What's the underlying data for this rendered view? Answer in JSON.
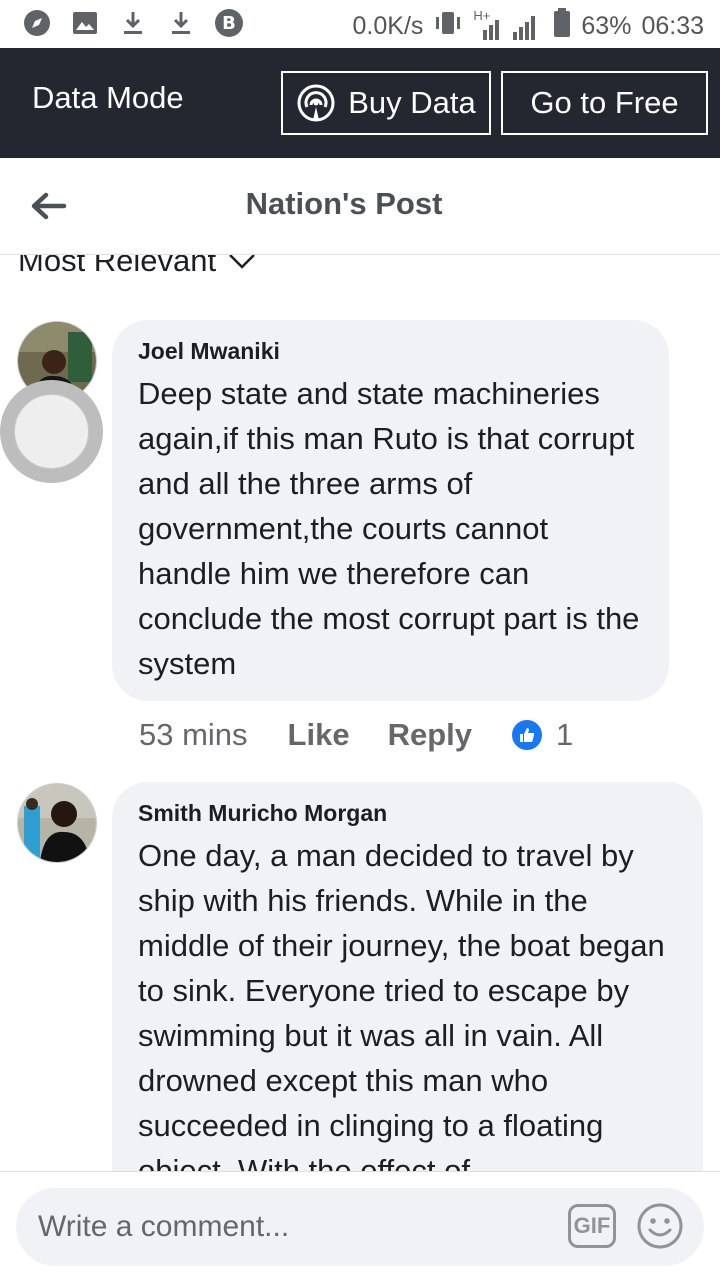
{
  "status_bar": {
    "speed": "0.0K/s",
    "network": "H+",
    "battery": "63%",
    "time": "06:33",
    "icons": [
      "compass-icon",
      "image-icon",
      "download-icon",
      "download-icon",
      "b-badge-icon",
      "vibrate-icon",
      "signal-icon",
      "battery-icon"
    ]
  },
  "data_bar": {
    "label": "Data Mode",
    "buy_label": "Buy Data",
    "free_label": "Go to Free"
  },
  "header": {
    "title": "Nation's Post"
  },
  "sort": {
    "label": "Most Relevant"
  },
  "comments": [
    {
      "author": "Joel Mwaniki",
      "text": "Deep state and state machineries again,if this man Ruto is that corrupt and all the three arms of government,the courts cannot handle him we therefore can conclude the most corrupt part is the system",
      "time": "53 mins",
      "like_label": "Like",
      "reply_label": "Reply",
      "reactions": "1"
    },
    {
      "author": "Smith Muricho Morgan",
      "text": "One day, a man decided to travel by ship with his friends. While in the middle of their journey, the boat began to sink. Everyone tried to escape by swimming but it was all in vain. All drowned except this man who succeeded in clinging to a floating object. With the effect of"
    }
  ],
  "composer": {
    "placeholder": "Write a comment...",
    "gif_label": "GIF"
  },
  "colors": {
    "data_bar_bg": "#232730",
    "bubble_bg": "#f0f2f5",
    "like_blue": "#1877f2"
  }
}
